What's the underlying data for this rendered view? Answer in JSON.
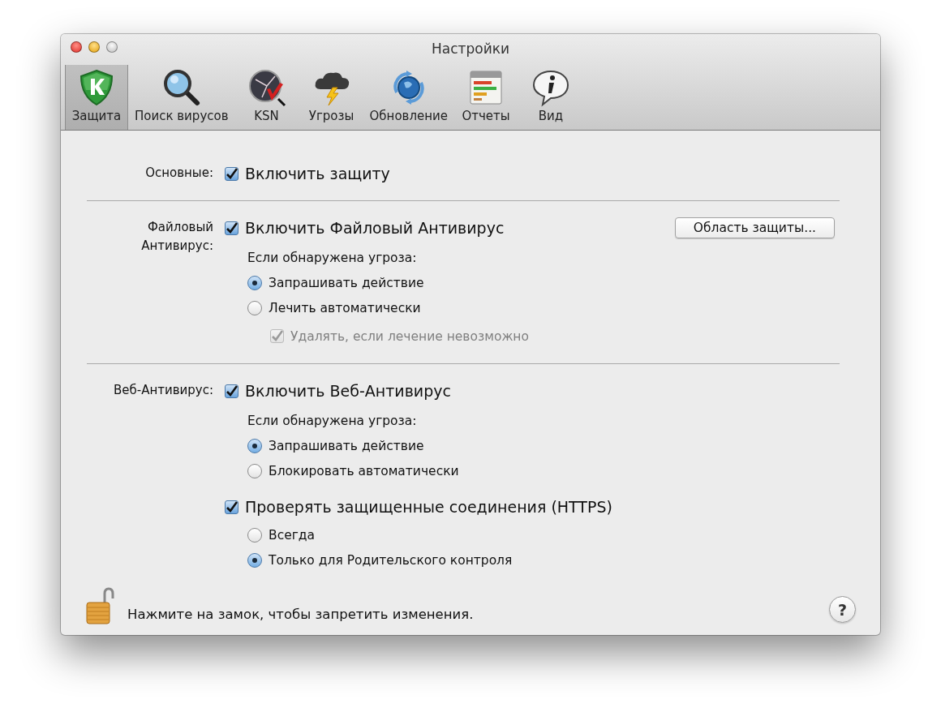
{
  "window": {
    "title": "Настройки"
  },
  "toolbar": [
    {
      "label": "Защита",
      "kind": "shield",
      "selected": true
    },
    {
      "label": "Поиск вирусов",
      "kind": "magnifier",
      "selected": false
    },
    {
      "label": "KSN",
      "kind": "network",
      "selected": false
    },
    {
      "label": "Угрозы",
      "kind": "storm",
      "selected": false
    },
    {
      "label": "Обновление",
      "kind": "update",
      "selected": false
    },
    {
      "label": "Отчеты",
      "kind": "reports",
      "selected": false
    },
    {
      "label": "Вид",
      "kind": "info",
      "selected": false
    }
  ],
  "sections": [
    {
      "label": "Основные:",
      "items": [
        {
          "kind": "checkbox",
          "label": "Включить защиту",
          "checked": true,
          "disabled": false
        }
      ]
    },
    {
      "label": "Файловый Антивирус:",
      "items": [
        {
          "kind": "checkbox",
          "label": "Включить Файловый Антивирус",
          "checked": true,
          "disabled": false,
          "button": "Область защиты...",
          "children": [
            {
              "kind": "caption",
              "label": "Если обнаружена угроза:"
            },
            {
              "kind": "radio",
              "label": "Запрашивать действие",
              "selected": true
            },
            {
              "kind": "radio",
              "label": "Лечить автоматически",
              "selected": false,
              "children": [
                {
                  "kind": "checkbox",
                  "label": "Удалять, если лечение невозможно",
                  "checked": true,
                  "disabled": true
                }
              ]
            }
          ]
        }
      ]
    },
    {
      "label": "Веб-Антивирус:",
      "items": [
        {
          "kind": "checkbox",
          "label": "Включить Веб-Антивирус",
          "checked": true,
          "disabled": false,
          "children": [
            {
              "kind": "caption",
              "label": "Если обнаружена угроза:"
            },
            {
              "kind": "radio",
              "label": "Запрашивать действие",
              "selected": true
            },
            {
              "kind": "radio",
              "label": "Блокировать автоматически",
              "selected": false
            }
          ]
        },
        {
          "kind": "checkbox",
          "label": "Проверять защищенные соединения (HTTPS)",
          "checked": true,
          "disabled": false,
          "children": [
            {
              "kind": "radio",
              "label": "Всегда",
              "selected": false
            },
            {
              "kind": "radio",
              "label": "Только для Родительского контроля",
              "selected": true
            }
          ]
        }
      ]
    }
  ],
  "footer": {
    "text": "Нажмите на замок, чтобы запретить изменения.",
    "help": "?"
  }
}
